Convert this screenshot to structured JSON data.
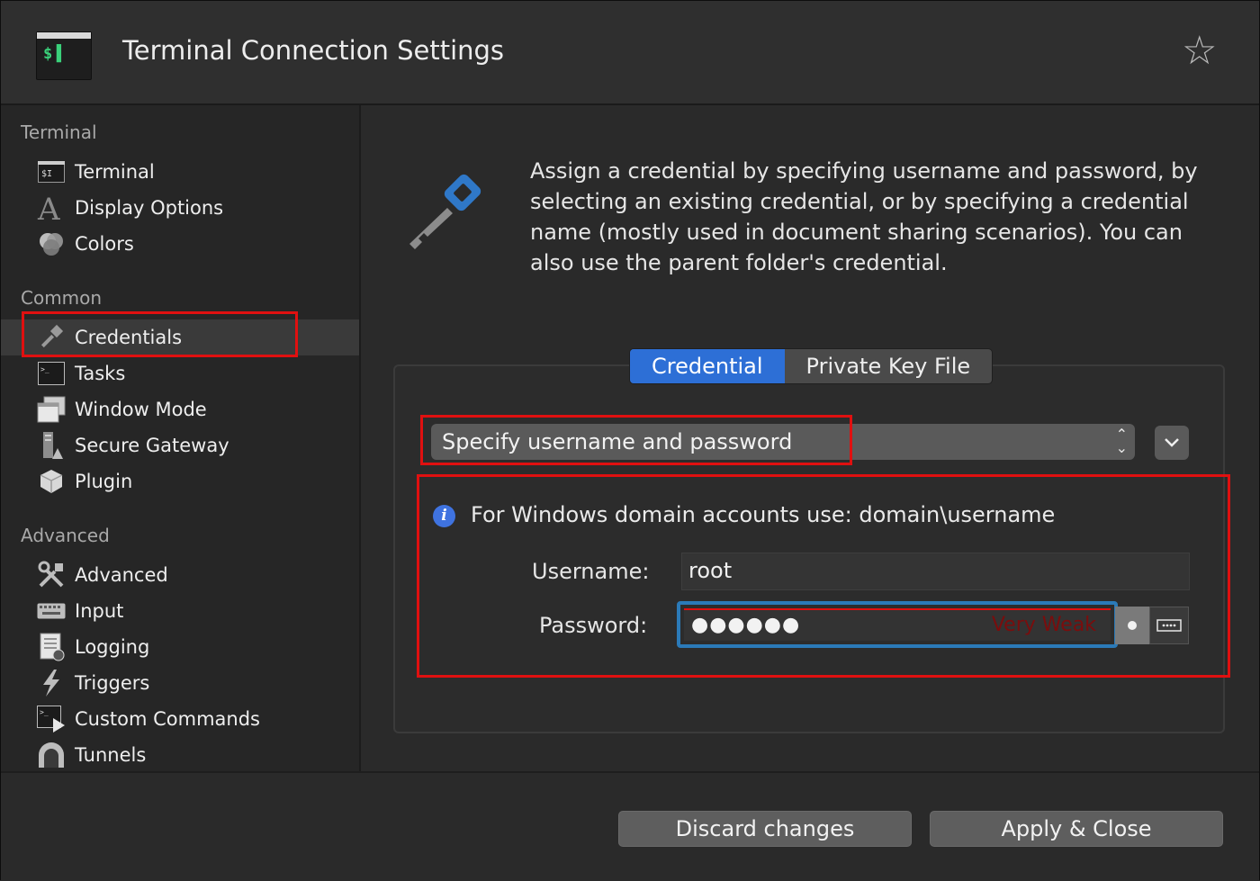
{
  "window": {
    "title": "Terminal Connection Settings",
    "app_icon_glyph": "$",
    "favorite_icon": "star-icon"
  },
  "sidebar": {
    "sections": [
      {
        "title": "Terminal",
        "items": [
          {
            "label": "Terminal",
            "icon": "terminal-icon"
          },
          {
            "label": "Display Options",
            "icon": "font-icon"
          },
          {
            "label": "Colors",
            "icon": "colors-icon"
          }
        ]
      },
      {
        "title": "Common",
        "items": [
          {
            "label": "Credentials",
            "icon": "key-icon",
            "selected": true
          },
          {
            "label": "Tasks",
            "icon": "tasks-icon"
          },
          {
            "label": "Window Mode",
            "icon": "window-mode-icon"
          },
          {
            "label": "Secure Gateway",
            "icon": "gateway-icon"
          },
          {
            "label": "Plugin",
            "icon": "plugin-icon"
          }
        ]
      },
      {
        "title": "Advanced",
        "items": [
          {
            "label": "Advanced",
            "icon": "tools-icon"
          },
          {
            "label": "Input",
            "icon": "keyboard-icon"
          },
          {
            "label": "Logging",
            "icon": "logging-icon"
          },
          {
            "label": "Triggers",
            "icon": "lightning-icon"
          },
          {
            "label": "Custom Commands",
            "icon": "custom-commands-icon"
          },
          {
            "label": "Tunnels",
            "icon": "tunnel-icon"
          }
        ]
      }
    ]
  },
  "main": {
    "description": "Assign a credential by specifying username and password, by selecting an existing credential, or by specifying a credential name (mostly used in document sharing scenarios). You can also use the parent folder's credential.",
    "tabs": [
      {
        "label": "Credential",
        "active": true
      },
      {
        "label": "Private Key File",
        "active": false
      }
    ],
    "mode_select": {
      "value": "Specify username and password"
    },
    "info_text": "For Windows domain accounts use: domain\\username",
    "username": {
      "label": "Username:",
      "value": "root"
    },
    "password": {
      "label": "Password:",
      "masked_value": "●●●●●●",
      "strength": "Very Weak"
    }
  },
  "footer": {
    "discard_label": "Discard changes",
    "apply_label": "Apply & Close"
  },
  "colors": {
    "accent": "#2d6fd6",
    "highlight": "#e01010",
    "focus_ring": "#2b7ab8",
    "terminal_green": "#3ad17a"
  }
}
